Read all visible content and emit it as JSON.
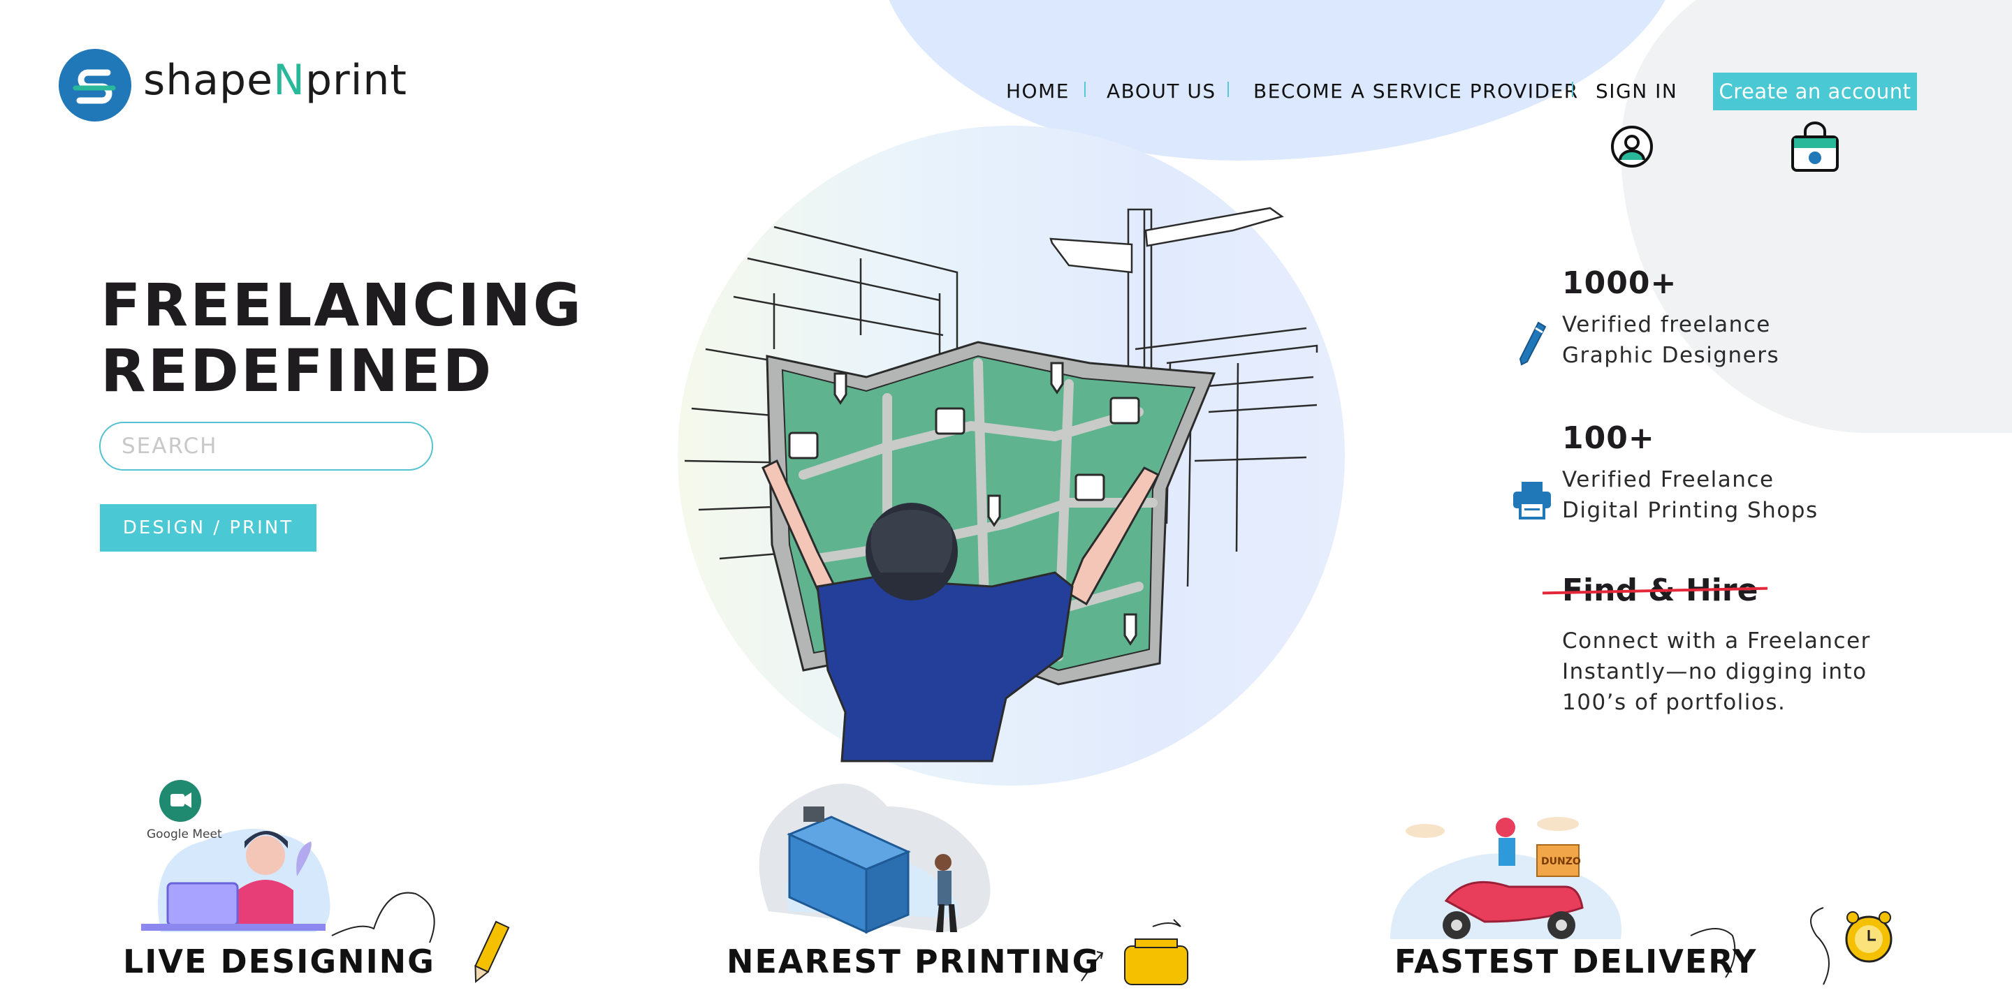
{
  "brand": {
    "name_part1": "shape",
    "name_part2": "N",
    "name_part3": "print"
  },
  "nav": {
    "home": "HOME",
    "about": "ABOUT US",
    "provider": "BECOME A SERVICE PROVIDER",
    "signin": "SIGN IN",
    "create": "Create an account"
  },
  "icons": {
    "user": "user-circle-icon",
    "bag": "shopping-bag-icon",
    "pen": "pen-icon",
    "printer": "printer-icon"
  },
  "hero": {
    "headline_line1": "FREELANCING",
    "headline_line2": "REDEFINED",
    "search_placeholder": "SEARCH",
    "button": "DESIGN / PRINT"
  },
  "stats": [
    {
      "number": "1000+",
      "line1": "Verified freelance",
      "line2": "Graphic Designers"
    },
    {
      "number": "100+",
      "line1": "Verified Freelance",
      "line2": "Digital Printing Shops"
    }
  ],
  "find": {
    "title": "Find & Hire",
    "line1": "Connect with a Freelancer",
    "line2": "Instantly—no digging into",
    "line3": "100’s of portfolios."
  },
  "features": [
    {
      "title": "LIVE DESIGNING",
      "meet_label": "Google Meet"
    },
    {
      "title": "NEAREST PRINTING"
    },
    {
      "title": "FASTEST DELIVERY",
      "box_label": "DUNZO"
    }
  ],
  "colors": {
    "accent": "#4ac8d3",
    "logo_blue": "#2178b8",
    "logo_green": "#29b89a",
    "strike": "#e4283a",
    "map_green": "#5fb48f"
  }
}
